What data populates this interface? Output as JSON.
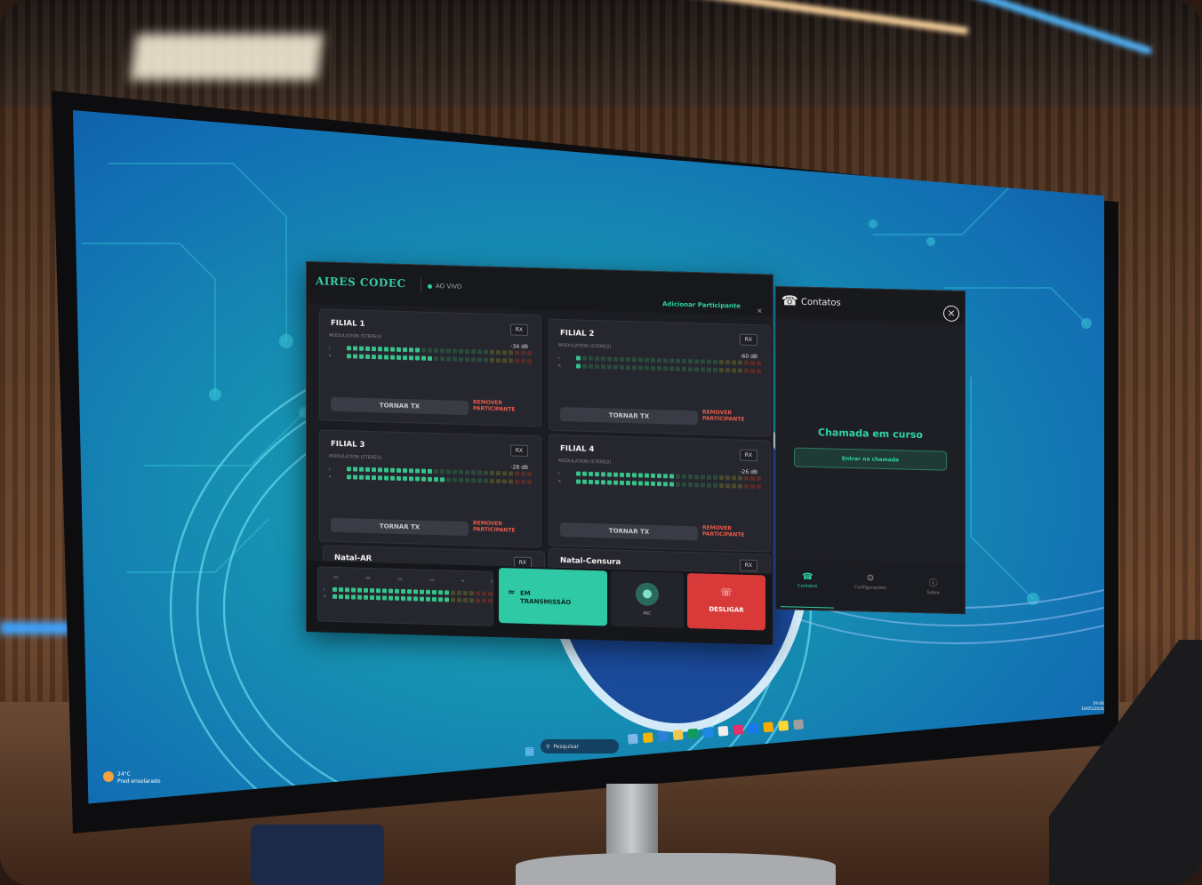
{
  "app": {
    "title": "AIRES CODEC",
    "live_label": "AO VIVO",
    "add_participant": "Adicionar Participante",
    "close_symbol": "×"
  },
  "participants": [
    {
      "name": "FILIAL 1",
      "badge": "RX",
      "modulation": "MODULATION (STEREO)",
      "level": "-34 dB",
      "tx_button": "TORNAR TX",
      "remove_button": "REMOVER PARTICIPANTE",
      "channels": [
        "L",
        "R"
      ]
    },
    {
      "name": "FILIAL 2",
      "badge": "RX",
      "modulation": "MODULATION (STEREO)",
      "level": "-60 dB",
      "tx_button": "TORNAR TX",
      "remove_button": "REMOVER PARTICIPANTE",
      "channels": [
        "L",
        "R"
      ]
    },
    {
      "name": "FILIAL 3",
      "badge": "RX",
      "modulation": "MODULATION (STEREO)",
      "level": "-28 dB",
      "tx_button": "TORNAR TX",
      "remove_button": "REMOVER PARTICIPANTE",
      "channels": [
        "L",
        "R"
      ]
    },
    {
      "name": "FILIAL 4",
      "badge": "RX",
      "modulation": "MODULATION (STEREO)",
      "level": "-26 dB",
      "tx_button": "TORNAR TX",
      "remove_button": "REMOVER PARTICIPANTE",
      "channels": [
        "L",
        "R"
      ]
    },
    {
      "name": "Natal-AR",
      "badge": "RX"
    },
    {
      "name": "Natal-Censura",
      "badge": "RX"
    }
  ],
  "meter_levels": [
    {
      "l": 0.4,
      "r": 0.48
    },
    {
      "l": 0.02,
      "r": 0.02
    },
    {
      "l": 0.48,
      "r": 0.54
    },
    {
      "l": 0.52,
      "r": 0.52
    }
  ],
  "master": {
    "scale": [
      "-60",
      "-48",
      "-24",
      "-12",
      "-6",
      "0"
    ],
    "channels": [
      "L",
      "R"
    ],
    "level": 0.72
  },
  "controls": {
    "transmit_label_1": "EM",
    "transmit_label_2": "TRANSMISSÃO",
    "mic_label": "MIC",
    "hangup_label": "DESLIGAR"
  },
  "contacts": {
    "title": "Contatos",
    "status": "Chamada em curso",
    "join_button": "Entrar na chamada",
    "tabs": [
      {
        "label": "Contatos",
        "active": true
      },
      {
        "label": "Configurações",
        "active": false
      },
      {
        "label": "Sobre",
        "active": false
      }
    ]
  },
  "taskbar": {
    "temperature": "24°C",
    "weather": "Pred ensolarado",
    "search_placeholder": "Pesquisar",
    "time": "19:06",
    "date": "19/05/2026"
  },
  "colors": {
    "accent": "#2fd3a8",
    "danger": "#d83a3a",
    "window_bg": "#1c1d22"
  }
}
